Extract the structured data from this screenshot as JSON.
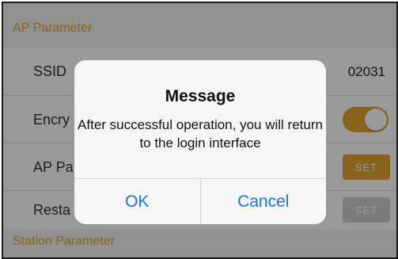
{
  "sections": {
    "ap_parameter": "AP Parameter",
    "station_parameter": "Station Parameter"
  },
  "rows": {
    "ssid": {
      "label": "SSID",
      "value": "02031"
    },
    "encryption": {
      "label": "Encry",
      "toggle_on": true
    },
    "ap_password": {
      "label": "AP Pa",
      "button": "SET"
    },
    "restart": {
      "label": "Resta",
      "button": "SET"
    }
  },
  "dialog": {
    "title": "Message",
    "message": "After successful operation, you will return to the login interface",
    "ok_label": "OK",
    "cancel_label": "Cancel"
  },
  "colors": {
    "accent": "#e5a42f",
    "link": "#1a73e8",
    "disabled": "#cfcfcf"
  }
}
